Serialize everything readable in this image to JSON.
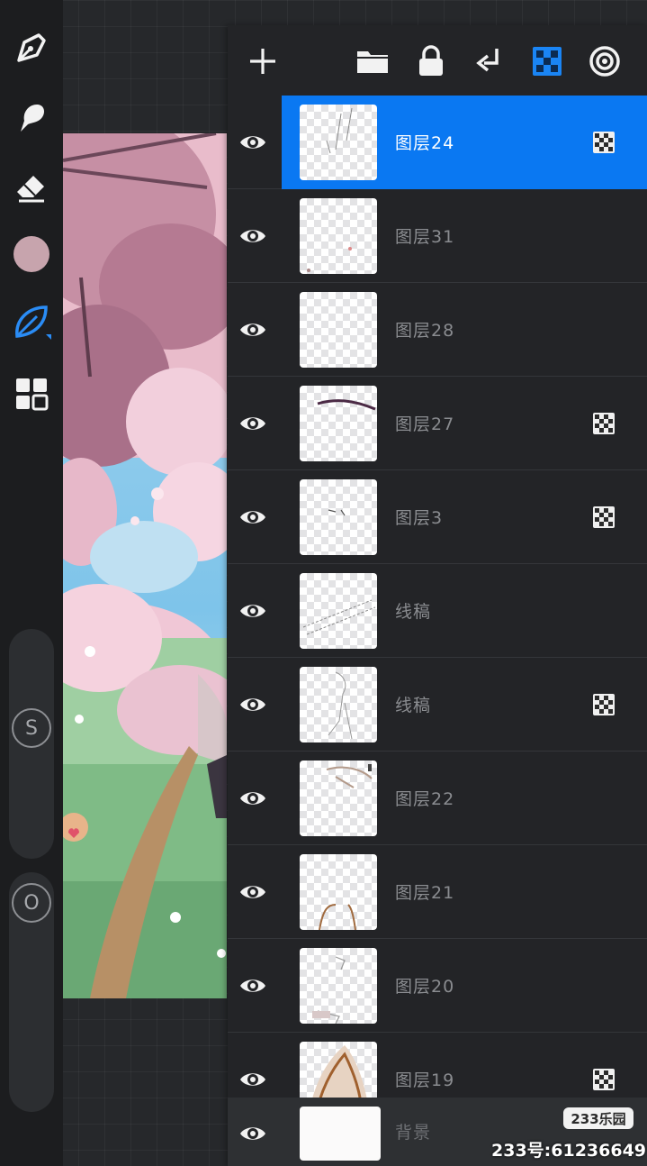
{
  "colors": {
    "accent": "#0a78f2",
    "current_brush_color": "#c7a4ad",
    "toolbar_bg": "#1c1d1f",
    "panel_bg": "#232427"
  },
  "left_toolbar": {
    "tools": [
      {
        "name": "paint-brush-icon",
        "active": false
      },
      {
        "name": "smudge-icon",
        "active": false
      },
      {
        "name": "eraser-icon",
        "active": false
      },
      {
        "name": "color-swatch",
        "active": false
      },
      {
        "name": "leaf-brush-icon",
        "active": true
      },
      {
        "name": "gallery-icon",
        "active": false
      }
    ],
    "size_slider_label": "S",
    "opacity_slider_label": "O"
  },
  "layers_panel": {
    "toolbar": [
      "add-layer-icon",
      "folder-icon",
      "lock-icon",
      "merge-down-icon",
      "alpha-lock-icon",
      "settings-icon"
    ],
    "layers": [
      {
        "name": "图层24",
        "visible": true,
        "selected": true,
        "alpha_locked": true
      },
      {
        "name": "图层31",
        "visible": true,
        "selected": false,
        "alpha_locked": false
      },
      {
        "name": "图层28",
        "visible": true,
        "selected": false,
        "alpha_locked": false
      },
      {
        "name": "图层27",
        "visible": true,
        "selected": false,
        "alpha_locked": true
      },
      {
        "name": "图层3",
        "visible": true,
        "selected": false,
        "alpha_locked": true
      },
      {
        "name": "线稿",
        "visible": true,
        "selected": false,
        "alpha_locked": false
      },
      {
        "name": "线稿",
        "visible": true,
        "selected": false,
        "alpha_locked": true
      },
      {
        "name": "图层22",
        "visible": true,
        "selected": false,
        "alpha_locked": false
      },
      {
        "name": "图层21",
        "visible": true,
        "selected": false,
        "alpha_locked": false
      },
      {
        "name": "图层20",
        "visible": true,
        "selected": false,
        "alpha_locked": false
      },
      {
        "name": "图层19",
        "visible": true,
        "selected": false,
        "alpha_locked": true
      }
    ],
    "background_layer": {
      "name": "背景",
      "visible": true
    }
  },
  "watermark": {
    "logo": "233乐园",
    "id_text": "233号:61236649"
  }
}
